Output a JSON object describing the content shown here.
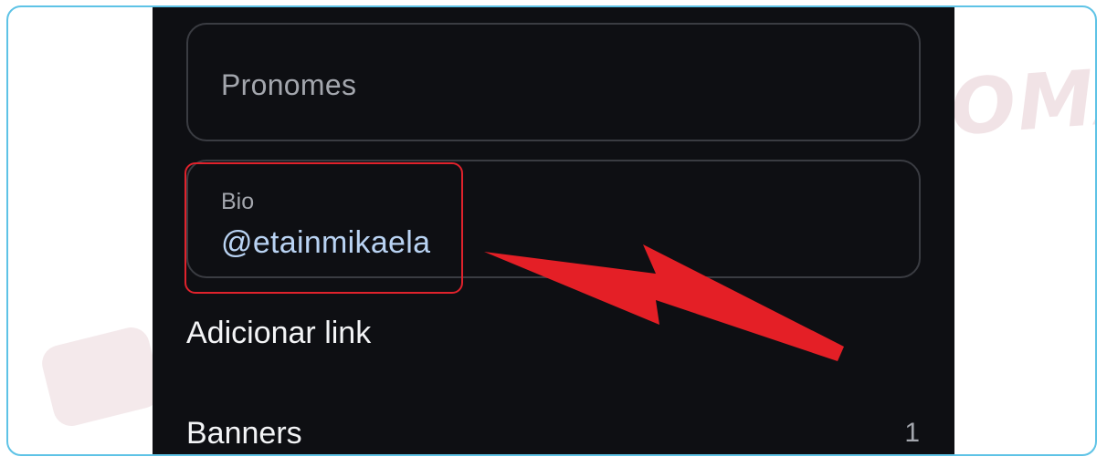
{
  "profile_form": {
    "pronouns_placeholder": "Pronomes",
    "bio_label": "Bio",
    "bio_value": "@etainmikaela"
  },
  "menu": {
    "add_link_label": "Adicionar link",
    "banners_label": "Banners",
    "banners_count": "1"
  },
  "watermark": {
    "brand": "PULSOMAX"
  },
  "colors": {
    "screen_background": "#0e0f13",
    "field_border": "#3a3c42",
    "highlight": "#e0222c",
    "frame_border": "#5ec3e6",
    "bio_value_text": "#b9d3f3"
  },
  "annotation": {
    "icon": "arrow-icon"
  }
}
